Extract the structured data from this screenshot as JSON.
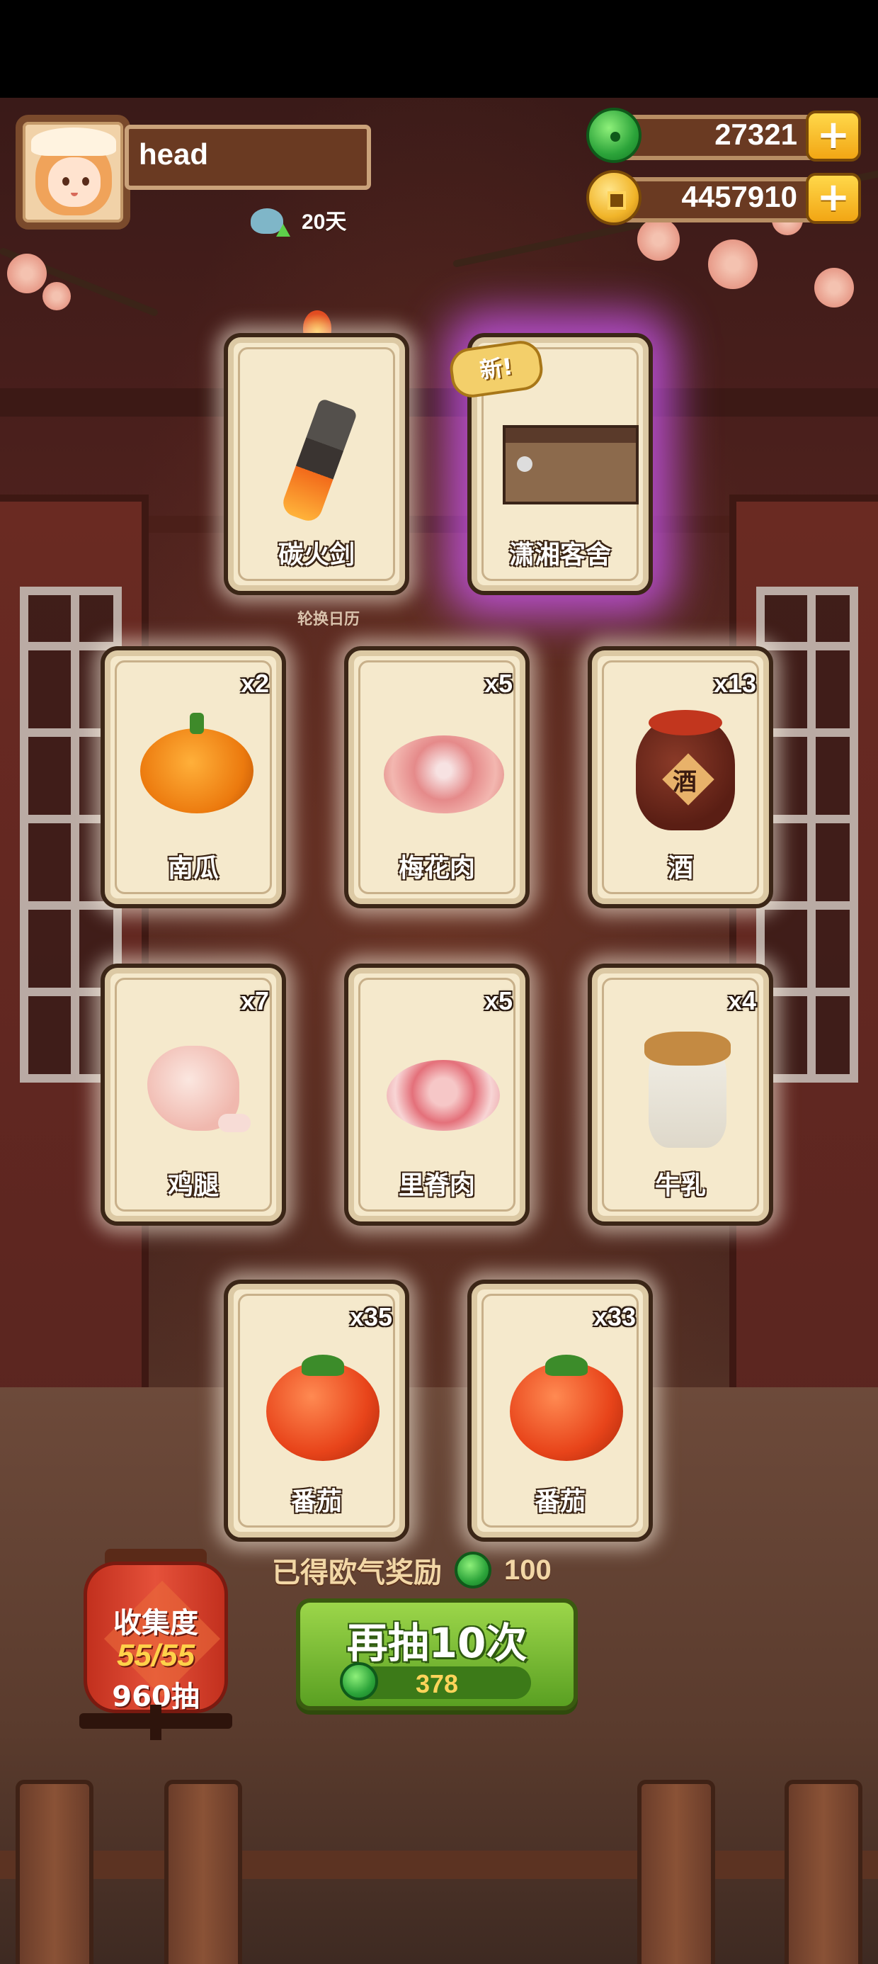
{
  "player": {
    "name": "head",
    "days": "20天"
  },
  "currencies": [
    {
      "name": "jade",
      "value": "27321"
    },
    {
      "name": "gold",
      "value": "4457910"
    }
  ],
  "plus_symbol": "+",
  "new_tag": "新!",
  "calendar_label": "轮换日历",
  "cards": [
    {
      "label": "碳火剑",
      "qty": "",
      "art": "sword-icon",
      "glow": "white"
    },
    {
      "label": "潇湘客舍",
      "qty": "",
      "art": "building-icon",
      "glow": "purple",
      "is_new": true
    },
    {
      "label": "南瓜",
      "qty": "x2",
      "art": "pumpkin-icon",
      "glow": "white"
    },
    {
      "label": "梅花肉",
      "qty": "x5",
      "art": "meat-icon",
      "glow": "white"
    },
    {
      "label": "酒",
      "qty": "x13",
      "art": "wine-jar-icon",
      "glow": "white"
    },
    {
      "label": "鸡腿",
      "qty": "x7",
      "art": "drumstick-icon",
      "glow": "white"
    },
    {
      "label": "里脊肉",
      "qty": "x5",
      "art": "tenderloin-icon",
      "glow": "white"
    },
    {
      "label": "牛乳",
      "qty": "x4",
      "art": "milk-jar-icon",
      "glow": "white"
    },
    {
      "label": "番茄",
      "qty": "x35",
      "art": "tomato-icon",
      "glow": "white"
    },
    {
      "label": "番茄",
      "qty": "x33",
      "art": "tomato-icon",
      "glow": "white"
    }
  ],
  "wine_char": "酒",
  "reward": {
    "text": "已得欧气奖励",
    "amount": "100"
  },
  "draw_button": {
    "label": "再抽10次",
    "cost": "378"
  },
  "collection": {
    "title": "收集度",
    "progress": "55/55",
    "draws": "960抽"
  }
}
